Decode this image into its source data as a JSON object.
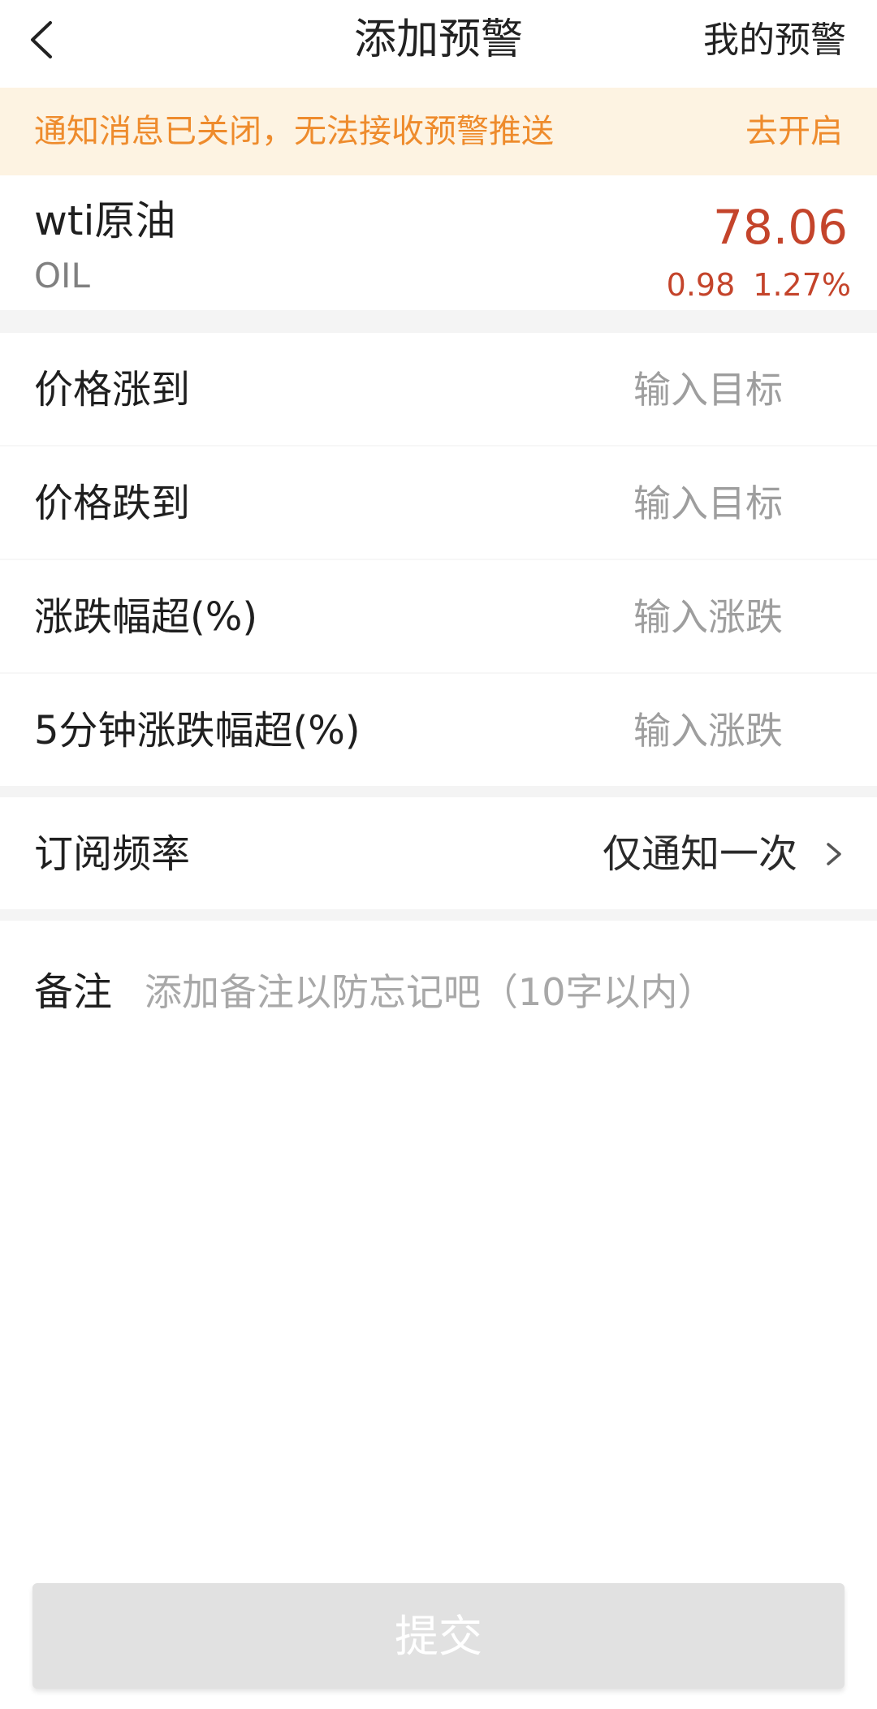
{
  "header": {
    "title": "添加预警",
    "right_link": "我的预警",
    "back_icon": "chevron-left-icon"
  },
  "notice": {
    "text": "通知消息已关闭，无法接收预警推送",
    "action": "去开启",
    "color": "#ee8b2c",
    "background": "#fdf3e2"
  },
  "instrument": {
    "name": "wti原油",
    "code": "OIL",
    "price": "78.06",
    "change": "0.98",
    "change_pct": "1.27%",
    "price_color": "#c4442b"
  },
  "conditions": [
    {
      "label": "价格涨到",
      "placeholder": "输入目标",
      "value": ""
    },
    {
      "label": "价格跌到",
      "placeholder": "输入目标",
      "value": ""
    },
    {
      "label": "涨跌幅超(%)",
      "placeholder": "输入涨跌",
      "value": ""
    },
    {
      "label": "5分钟涨跌幅超(%)",
      "placeholder": "输入涨跌",
      "value": ""
    }
  ],
  "frequency": {
    "label": "订阅频率",
    "value": "仅通知一次",
    "icon": "chevron-right-icon"
  },
  "note": {
    "label": "备注",
    "placeholder": "添加备注以防忘记吧（10字以内）",
    "value": ""
  },
  "submit": {
    "label": "提交",
    "enabled": false
  }
}
